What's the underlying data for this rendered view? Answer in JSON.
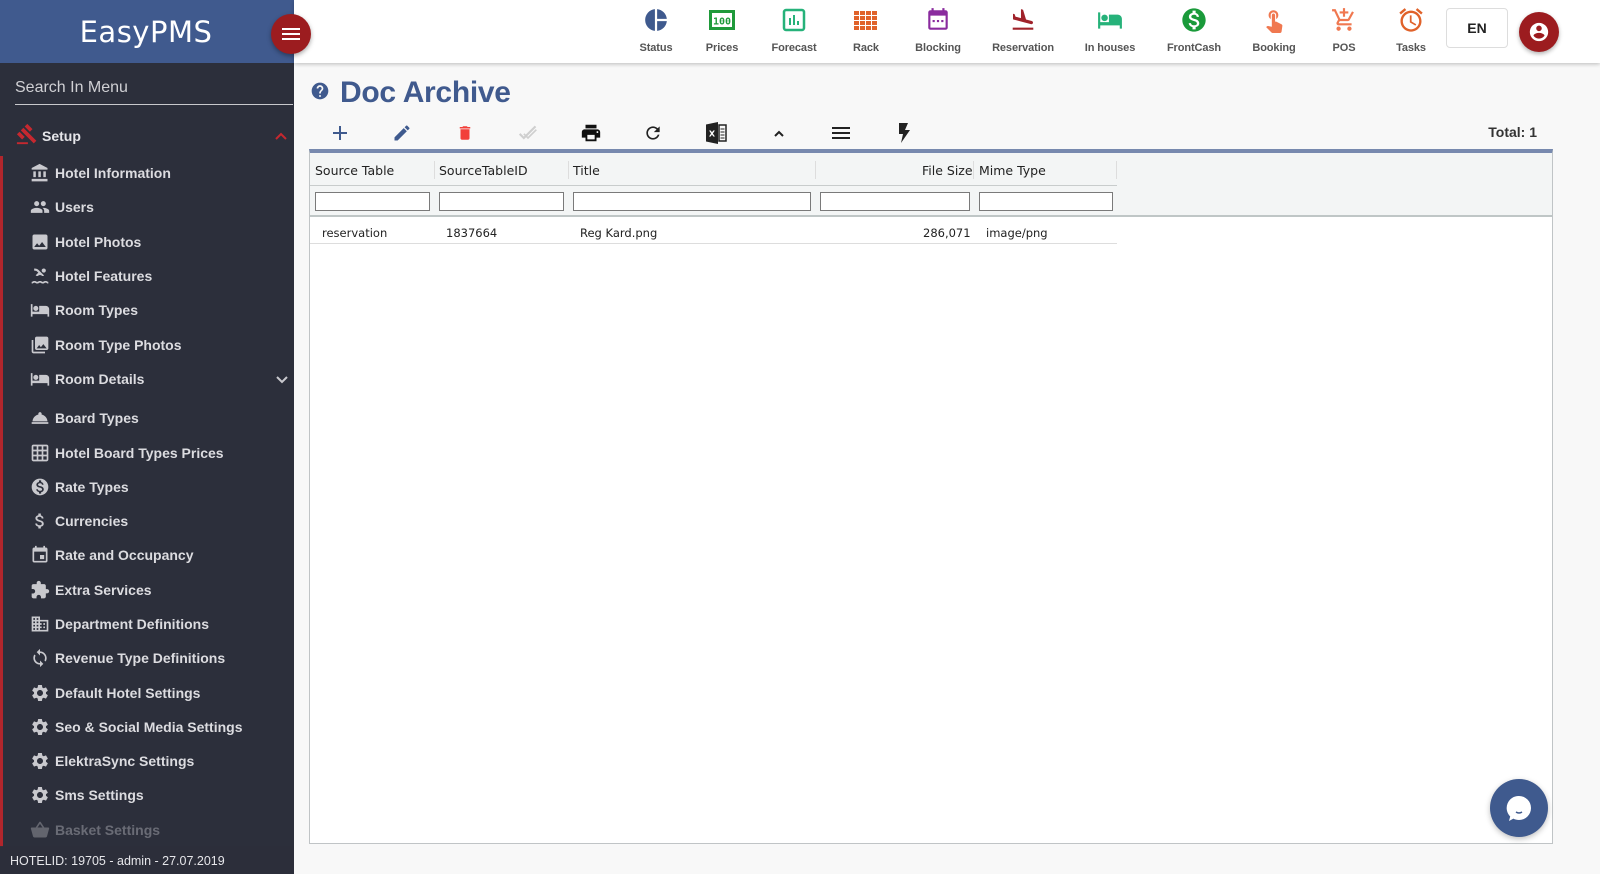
{
  "brand": {
    "name": "EasyPMS"
  },
  "sidebar": {
    "search_placeholder": "Search In Menu",
    "section": {
      "label": "Setup",
      "expanded": true
    },
    "items": [
      {
        "label": "Hotel Information",
        "icon": "bank-icon"
      },
      {
        "label": "Users",
        "icon": "users-icon"
      },
      {
        "label": "Hotel Photos",
        "icon": "photo-icon"
      },
      {
        "label": "Hotel Features",
        "icon": "pool-icon"
      },
      {
        "label": "Room Types",
        "icon": "bed-icon"
      },
      {
        "label": "Room Type Photos",
        "icon": "photo-library-icon"
      },
      {
        "label": "Room Details",
        "icon": "bed-icon",
        "has_submenu": true
      },
      {
        "label": "Board Types",
        "icon": "room-service-icon"
      },
      {
        "label": "Hotel Board Types Prices",
        "icon": "grid-icon"
      },
      {
        "label": "Rate Types",
        "icon": "dollar-circle-icon"
      },
      {
        "label": "Currencies",
        "icon": "dollar-icon"
      },
      {
        "label": "Rate and Occupancy",
        "icon": "calendar-icon"
      },
      {
        "label": "Extra Services",
        "icon": "puzzle-icon"
      },
      {
        "label": "Department Definitions",
        "icon": "building-icon"
      },
      {
        "label": "Revenue Type Definitions",
        "icon": "sync-icon"
      },
      {
        "label": "Default Hotel Settings",
        "icon": "gear-icon"
      },
      {
        "label": "Seo & Social Media Settings",
        "icon": "gear-icon"
      },
      {
        "label": "ElektraSync Settings",
        "icon": "gear-icon"
      },
      {
        "label": "Sms Settings",
        "icon": "gear-icon"
      },
      {
        "label": "Basket Settings",
        "icon": "basket-icon"
      }
    ],
    "footer": "HOTELID: 19705 - admin - 27.07.2019"
  },
  "topnav": {
    "items": [
      {
        "label": "Status",
        "icon": "pie-chart-icon",
        "color": "#3f5a8e"
      },
      {
        "label": "Prices",
        "icon": "prices-icon",
        "color": "#1f9a3a"
      },
      {
        "label": "Forecast",
        "icon": "bar-chart-icon",
        "color": "#26b27a"
      },
      {
        "label": "Rack",
        "icon": "rack-grid-icon",
        "color": "#e0622a"
      },
      {
        "label": "Blocking",
        "icon": "calendar-icon",
        "color": "#8a2b9e"
      },
      {
        "label": "Reservation",
        "icon": "flight-land-icon",
        "color": "#a0222a"
      },
      {
        "label": "In houses",
        "icon": "bed-icon",
        "color": "#26b27a"
      },
      {
        "label": "FrontCash",
        "icon": "dollar-circle-icon",
        "color": "#1a9a3a"
      },
      {
        "label": "Booking",
        "icon": "touch-icon",
        "color": "#f07850"
      },
      {
        "label": "POS",
        "icon": "cart-icon",
        "color": "#f07850"
      },
      {
        "label": "Tasks",
        "icon": "alarm-icon",
        "color": "#e0622a"
      }
    ],
    "language": "EN"
  },
  "page": {
    "title": "Doc Archive",
    "total_label": "Total: 1",
    "toolbar": [
      {
        "name": "add-button",
        "icon": "plus-icon"
      },
      {
        "name": "edit-button",
        "icon": "pencil-icon"
      },
      {
        "name": "delete-button",
        "icon": "trash-icon"
      },
      {
        "name": "approve-button",
        "icon": "double-check-icon",
        "disabled": true
      },
      {
        "name": "print-button",
        "icon": "printer-icon"
      },
      {
        "name": "refresh-button",
        "icon": "refresh-icon"
      },
      {
        "name": "export-excel-button",
        "icon": "excel-icon"
      },
      {
        "name": "collapse-button",
        "icon": "chevron-up-icon"
      },
      {
        "name": "columns-button",
        "icon": "menu-icon"
      },
      {
        "name": "actions-button",
        "icon": "flash-icon"
      }
    ]
  },
  "grid": {
    "columns": [
      "Source Table",
      "SourceTableID",
      "Title",
      "File Size",
      "Mime Type"
    ],
    "filters": [
      "",
      "",
      "",
      "",
      ""
    ],
    "rows": [
      {
        "source_table": "reservation",
        "source_table_id": "1837664",
        "title": "Reg Kard.png",
        "file_size": "286,071",
        "mime_type": "image/png"
      }
    ]
  }
}
